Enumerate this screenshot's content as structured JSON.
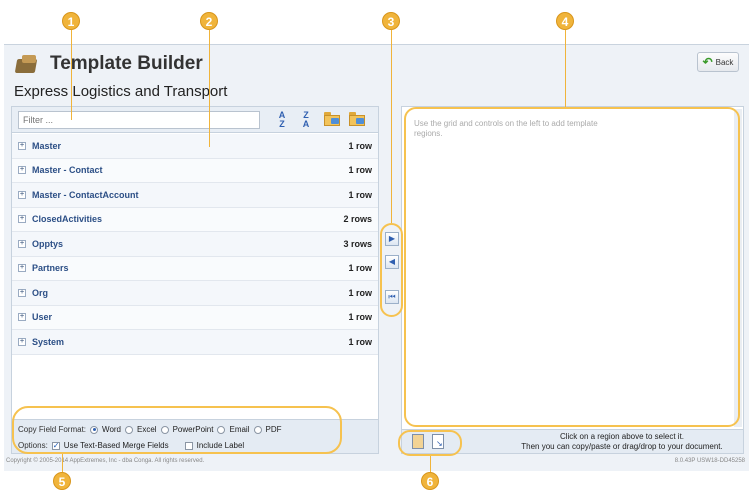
{
  "header": {
    "title": "Template Builder",
    "back_label": "Back",
    "company": "Express Logistics and Transport"
  },
  "filter": {
    "placeholder": "Filter ..."
  },
  "toolbar": {
    "sort_az_top": "A",
    "sort_az_bottom": "Z",
    "sort_za_top": "Z",
    "sort_za_bottom": "A"
  },
  "rows": [
    {
      "name": "Master",
      "count": "1 row"
    },
    {
      "name": "Master - Contact",
      "count": "1 row"
    },
    {
      "name": "Master - ContactAccount",
      "count": "1 row"
    },
    {
      "name": "ClosedActivities",
      "count": "2 rows"
    },
    {
      "name": "Opptys",
      "count": "3 rows"
    },
    {
      "name": "Partners",
      "count": "1 row"
    },
    {
      "name": "Org",
      "count": "1 row"
    },
    {
      "name": "User",
      "count": "1 row"
    },
    {
      "name": "System",
      "count": "1 row"
    }
  ],
  "format": {
    "label": "Copy Field Format:",
    "options": [
      "Word",
      "Excel",
      "PowerPoint",
      "Email",
      "PDF"
    ],
    "selected": "Word"
  },
  "options": {
    "label": "Options:",
    "text_merge": "Use Text-Based Merge Fields",
    "text_merge_checked": true,
    "include_label": "Include Label",
    "include_label_checked": false
  },
  "right_panel": {
    "instructions": "Use the grid and controls on the left to add template regions.",
    "hint_line1": "Click on a region above to select it.",
    "hint_line2": "Then you can copy/paste or drag/drop to your document."
  },
  "footer": {
    "copyright": "Copyright © 2005-2014 AppExtremes, Inc - dba Conga. All rights reserved.",
    "version": "8.0.43P USW18-DD45258"
  },
  "callouts": [
    "1",
    "2",
    "3",
    "4",
    "5",
    "6"
  ],
  "colors": {
    "callout": "#f0b43b",
    "accent": "#2c4f86"
  }
}
